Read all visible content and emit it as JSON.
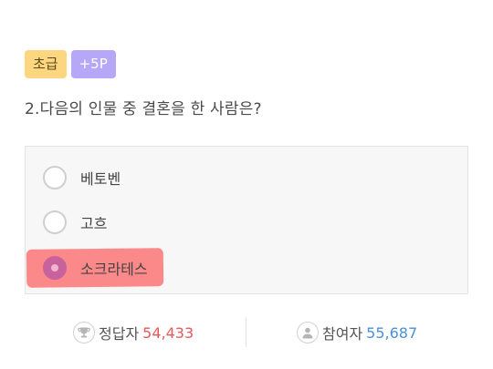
{
  "badges": {
    "level": "초급",
    "points": "+5P"
  },
  "question": {
    "text": "2.다음의 인물 중 결혼을 한 사람은?"
  },
  "options": [
    {
      "label": "베토벤",
      "selected": false
    },
    {
      "label": "고흐",
      "selected": false
    },
    {
      "label": "소크라테스",
      "selected": true
    }
  ],
  "stats": {
    "correct_label": "정답자",
    "correct_value": "54,433",
    "participants_label": "참여자",
    "participants_value": "55,687"
  },
  "colors": {
    "level_badge": "#fcd77f",
    "points_badge": "#b6a7f7",
    "selected_radio": "#c8629c",
    "highlight": "#ff4646",
    "correct_value": "#e75a5a",
    "participants_value": "#4a90d9"
  },
  "icons": {
    "correct": "trophy-icon",
    "participants": "person-icon"
  }
}
